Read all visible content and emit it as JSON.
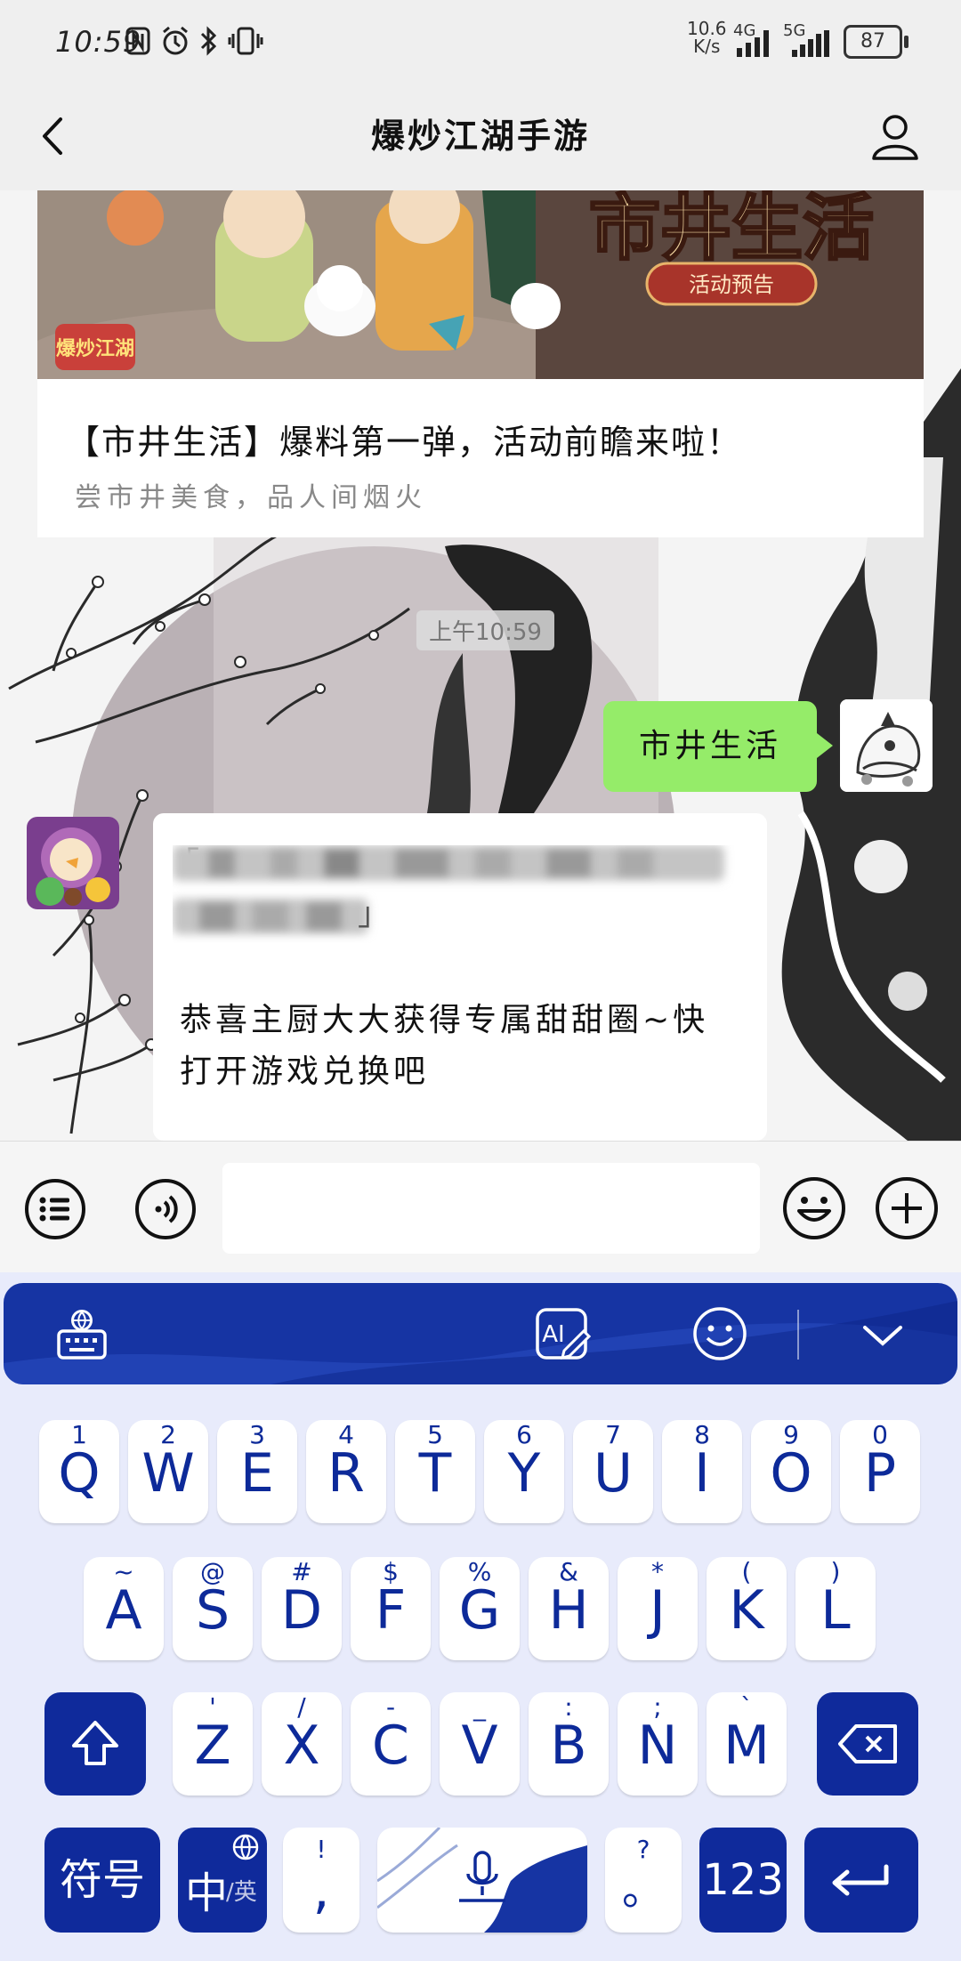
{
  "status_bar": {
    "time": "10:59",
    "net_speed_value": "10.6",
    "net_speed_unit": "K/s",
    "signal_1": "4G",
    "signal_2": "5G",
    "battery": "87"
  },
  "header": {
    "title": "爆炒江湖手游"
  },
  "chat": {
    "article": {
      "banner_text": "市井生活",
      "banner_tag": "活动预告",
      "banner_logo": "爆炒江湖",
      "title": "【市井生活】爆料第一弹，活动前瞻来啦！",
      "subtitle": "尝市井美食，品人间烟火"
    },
    "timestamp": "上午10:59",
    "sent_message": "市井生活",
    "received_message_line1": "恭喜主厨大大获得专属甜甜圈~快",
    "received_message_line2": "打开游戏兑换吧",
    "received_quote_open": "「",
    "received_quote_close": "」"
  },
  "input_bar": {
    "input_value": ""
  },
  "keyboard": {
    "toolbar": {
      "ai_label": "AI"
    },
    "row1": [
      {
        "main": "Q",
        "hint": "1"
      },
      {
        "main": "W",
        "hint": "2"
      },
      {
        "main": "E",
        "hint": "3"
      },
      {
        "main": "R",
        "hint": "4"
      },
      {
        "main": "T",
        "hint": "5"
      },
      {
        "main": "Y",
        "hint": "6"
      },
      {
        "main": "U",
        "hint": "7"
      },
      {
        "main": "I",
        "hint": "8"
      },
      {
        "main": "O",
        "hint": "9"
      },
      {
        "main": "P",
        "hint": "0"
      }
    ],
    "row2": [
      {
        "main": "A",
        "hint": "~"
      },
      {
        "main": "S",
        "hint": "@"
      },
      {
        "main": "D",
        "hint": "#"
      },
      {
        "main": "F",
        "hint": "$"
      },
      {
        "main": "G",
        "hint": "%"
      },
      {
        "main": "H",
        "hint": "&"
      },
      {
        "main": "J",
        "hint": "*"
      },
      {
        "main": "K",
        "hint": "("
      },
      {
        "main": "L",
        "hint": ")"
      }
    ],
    "row3": [
      {
        "main": "Z",
        "hint": "'"
      },
      {
        "main": "X",
        "hint": "/"
      },
      {
        "main": "C",
        "hint": "-"
      },
      {
        "main": "V",
        "hint": "_"
      },
      {
        "main": "B",
        "hint": ":"
      },
      {
        "main": "N",
        "hint": ";"
      },
      {
        "main": "M",
        "hint": "`"
      }
    ],
    "symbols_label": "符号",
    "lang_main": "中",
    "lang_alt": "/英",
    "comma_main": ",",
    "comma_hint": "!",
    "period_main": "。",
    "period_hint": "?",
    "numbers_label": "123",
    "accent_color": "#0f2a9b"
  }
}
